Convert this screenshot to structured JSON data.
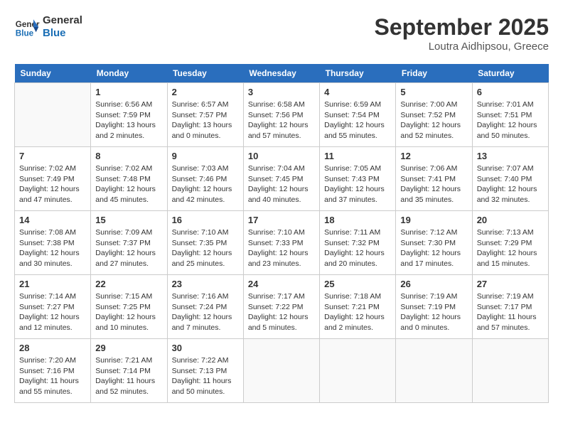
{
  "header": {
    "logo_line1": "General",
    "logo_line2": "Blue",
    "month_title": "September 2025",
    "location": "Loutra Aidhipsou, Greece"
  },
  "weekdays": [
    "Sunday",
    "Monday",
    "Tuesday",
    "Wednesday",
    "Thursday",
    "Friday",
    "Saturday"
  ],
  "weeks": [
    [
      {
        "day": "",
        "empty": true
      },
      {
        "day": "1",
        "sunrise": "6:56 AM",
        "sunset": "7:59 PM",
        "daylight": "13 hours and 2 minutes."
      },
      {
        "day": "2",
        "sunrise": "6:57 AM",
        "sunset": "7:57 PM",
        "daylight": "13 hours and 0 minutes."
      },
      {
        "day": "3",
        "sunrise": "6:58 AM",
        "sunset": "7:56 PM",
        "daylight": "12 hours and 57 minutes."
      },
      {
        "day": "4",
        "sunrise": "6:59 AM",
        "sunset": "7:54 PM",
        "daylight": "12 hours and 55 minutes."
      },
      {
        "day": "5",
        "sunrise": "7:00 AM",
        "sunset": "7:52 PM",
        "daylight": "12 hours and 52 minutes."
      },
      {
        "day": "6",
        "sunrise": "7:01 AM",
        "sunset": "7:51 PM",
        "daylight": "12 hours and 50 minutes."
      }
    ],
    [
      {
        "day": "7",
        "sunrise": "7:02 AM",
        "sunset": "7:49 PM",
        "daylight": "12 hours and 47 minutes."
      },
      {
        "day": "8",
        "sunrise": "7:02 AM",
        "sunset": "7:48 PM",
        "daylight": "12 hours and 45 minutes."
      },
      {
        "day": "9",
        "sunrise": "7:03 AM",
        "sunset": "7:46 PM",
        "daylight": "12 hours and 42 minutes."
      },
      {
        "day": "10",
        "sunrise": "7:04 AM",
        "sunset": "7:45 PM",
        "daylight": "12 hours and 40 minutes."
      },
      {
        "day": "11",
        "sunrise": "7:05 AM",
        "sunset": "7:43 PM",
        "daylight": "12 hours and 37 minutes."
      },
      {
        "day": "12",
        "sunrise": "7:06 AM",
        "sunset": "7:41 PM",
        "daylight": "12 hours and 35 minutes."
      },
      {
        "day": "13",
        "sunrise": "7:07 AM",
        "sunset": "7:40 PM",
        "daylight": "12 hours and 32 minutes."
      }
    ],
    [
      {
        "day": "14",
        "sunrise": "7:08 AM",
        "sunset": "7:38 PM",
        "daylight": "12 hours and 30 minutes."
      },
      {
        "day": "15",
        "sunrise": "7:09 AM",
        "sunset": "7:37 PM",
        "daylight": "12 hours and 27 minutes."
      },
      {
        "day": "16",
        "sunrise": "7:10 AM",
        "sunset": "7:35 PM",
        "daylight": "12 hours and 25 minutes."
      },
      {
        "day": "17",
        "sunrise": "7:10 AM",
        "sunset": "7:33 PM",
        "daylight": "12 hours and 23 minutes."
      },
      {
        "day": "18",
        "sunrise": "7:11 AM",
        "sunset": "7:32 PM",
        "daylight": "12 hours and 20 minutes."
      },
      {
        "day": "19",
        "sunrise": "7:12 AM",
        "sunset": "7:30 PM",
        "daylight": "12 hours and 17 minutes."
      },
      {
        "day": "20",
        "sunrise": "7:13 AM",
        "sunset": "7:29 PM",
        "daylight": "12 hours and 15 minutes."
      }
    ],
    [
      {
        "day": "21",
        "sunrise": "7:14 AM",
        "sunset": "7:27 PM",
        "daylight": "12 hours and 12 minutes."
      },
      {
        "day": "22",
        "sunrise": "7:15 AM",
        "sunset": "7:25 PM",
        "daylight": "12 hours and 10 minutes."
      },
      {
        "day": "23",
        "sunrise": "7:16 AM",
        "sunset": "7:24 PM",
        "daylight": "12 hours and 7 minutes."
      },
      {
        "day": "24",
        "sunrise": "7:17 AM",
        "sunset": "7:22 PM",
        "daylight": "12 hours and 5 minutes."
      },
      {
        "day": "25",
        "sunrise": "7:18 AM",
        "sunset": "7:21 PM",
        "daylight": "12 hours and 2 minutes."
      },
      {
        "day": "26",
        "sunrise": "7:19 AM",
        "sunset": "7:19 PM",
        "daylight": "12 hours and 0 minutes."
      },
      {
        "day": "27",
        "sunrise": "7:19 AM",
        "sunset": "7:17 PM",
        "daylight": "11 hours and 57 minutes."
      }
    ],
    [
      {
        "day": "28",
        "sunrise": "7:20 AM",
        "sunset": "7:16 PM",
        "daylight": "11 hours and 55 minutes."
      },
      {
        "day": "29",
        "sunrise": "7:21 AM",
        "sunset": "7:14 PM",
        "daylight": "11 hours and 52 minutes."
      },
      {
        "day": "30",
        "sunrise": "7:22 AM",
        "sunset": "7:13 PM",
        "daylight": "11 hours and 50 minutes."
      },
      {
        "day": "",
        "empty": true
      },
      {
        "day": "",
        "empty": true
      },
      {
        "day": "",
        "empty": true
      },
      {
        "day": "",
        "empty": true
      }
    ]
  ]
}
